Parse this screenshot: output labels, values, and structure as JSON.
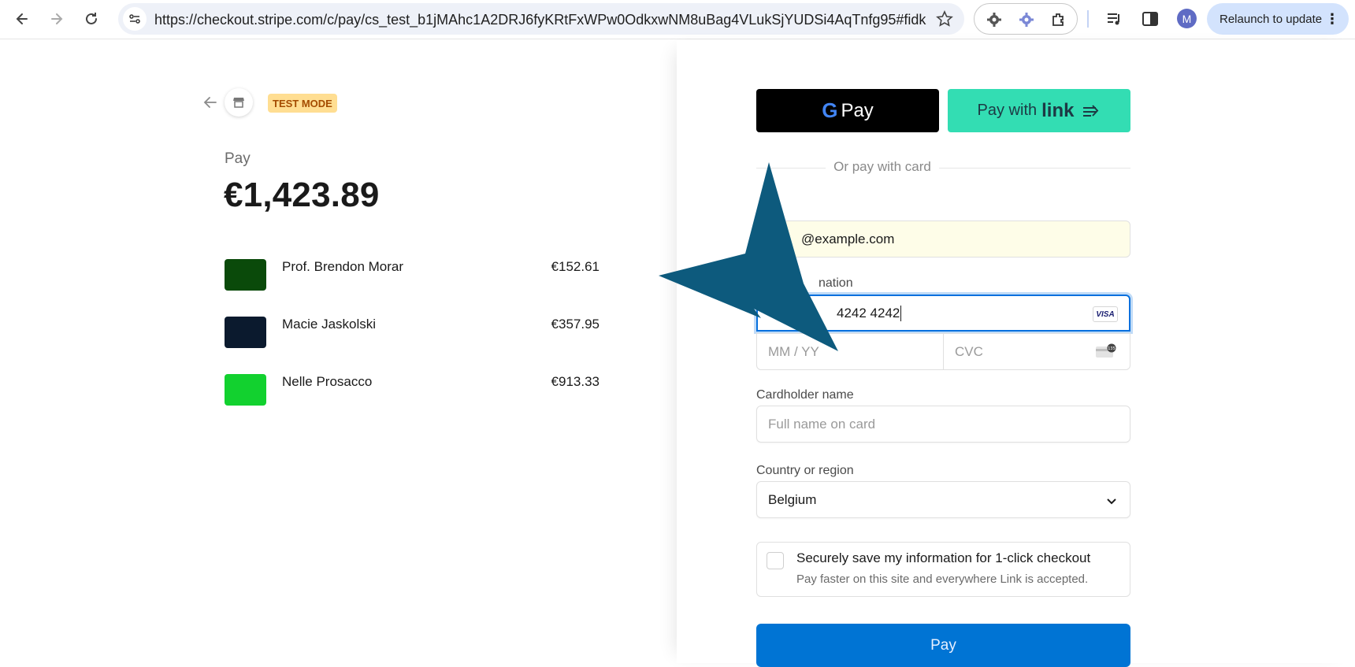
{
  "browser": {
    "url": "https://checkout.stripe.com/c/pay/cs_test_b1jMAhc1A2DRJ6fyKRtFxWPw0OdkxwNM8uBag4VLukSjYUDSi4AqTnfg95#fidkdWx...",
    "relaunch_label": "Relaunch to update",
    "avatar_initial": "M",
    "icons": [
      "back-icon",
      "forward-icon",
      "reload-icon",
      "site-info-icon",
      "bookmark-star-icon",
      "extension-gear-icon",
      "extension-puzzle-icon",
      "media-icon",
      "side-panel-icon",
      "menu-dots-icon"
    ]
  },
  "summary": {
    "test_mode_label": "TEST MODE",
    "pay_label": "Pay",
    "total": "€1,423.89",
    "items": [
      {
        "name": "Prof. Brendon Morar",
        "price": "€152.61",
        "thumb_color": "#0a4a0a"
      },
      {
        "name": "Macie Jaskolski",
        "price": "€357.95",
        "thumb_color": "#0b1a2e"
      },
      {
        "name": "Nelle Prosacco",
        "price": "€913.33",
        "thumb_color": "#12d12f"
      }
    ]
  },
  "payment": {
    "gpay_label": "Pay",
    "link_prefix": "Pay with",
    "link_word": "link",
    "divider_text": "Or pay with card",
    "email_value": "@example.com",
    "card_label": "nation",
    "card_number": "4242 4242",
    "card_brand": "VISA",
    "expiry_placeholder": "MM / YY",
    "cvc_placeholder": "CVC",
    "cvc_badge": "135",
    "cardholder_label": "Cardholder name",
    "cardholder_placeholder": "Full name on card",
    "country_label": "Country or region",
    "country_value": "Belgium",
    "save_title": "Securely save my information for 1-click checkout",
    "save_subtitle": "Pay faster on this site and everywhere Link is accepted.",
    "pay_button": "Pay"
  },
  "colors": {
    "accent": "#0570de",
    "pay_button": "#0074d4",
    "link_green": "#33ddb3",
    "test_badge": "#ffde92",
    "annotation_star": "#0d5a7d"
  }
}
